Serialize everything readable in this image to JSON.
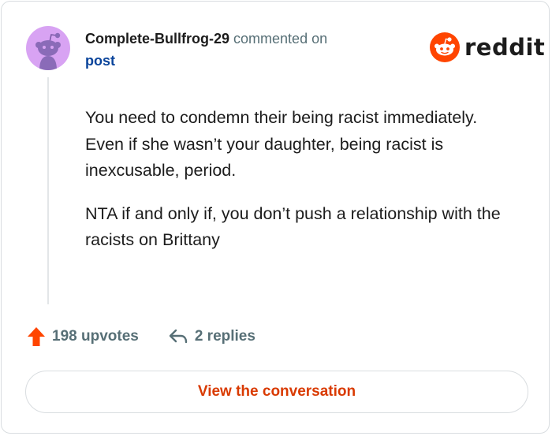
{
  "comment": {
    "author": "Complete-Bullfrog-29",
    "action_text": "commented on",
    "post_link": "post",
    "paragraphs": [
      "You need to condemn their being racist immediately. Even if she wasn’t your daughter, being racist is inexcusable, period.",
      "NTA if and only if, you don’t push a relationship with the racists on Brittany"
    ]
  },
  "brand": {
    "wordmark": "reddit",
    "color": "#ff4500"
  },
  "stats": {
    "upvotes_label": "198 upvotes",
    "replies_label": "2 replies"
  },
  "cta": {
    "label": "View the conversation"
  },
  "colors": {
    "upvote": "#ff4500",
    "cta_text": "#d93a00",
    "link": "#0a449b",
    "avatar_bg": "#d8a3f3"
  },
  "icons": {
    "avatar": "snoo-avatar-icon",
    "brand": "reddit-alien-icon",
    "upvote": "upvote-arrow-icon",
    "reply": "reply-arrow-icon"
  }
}
